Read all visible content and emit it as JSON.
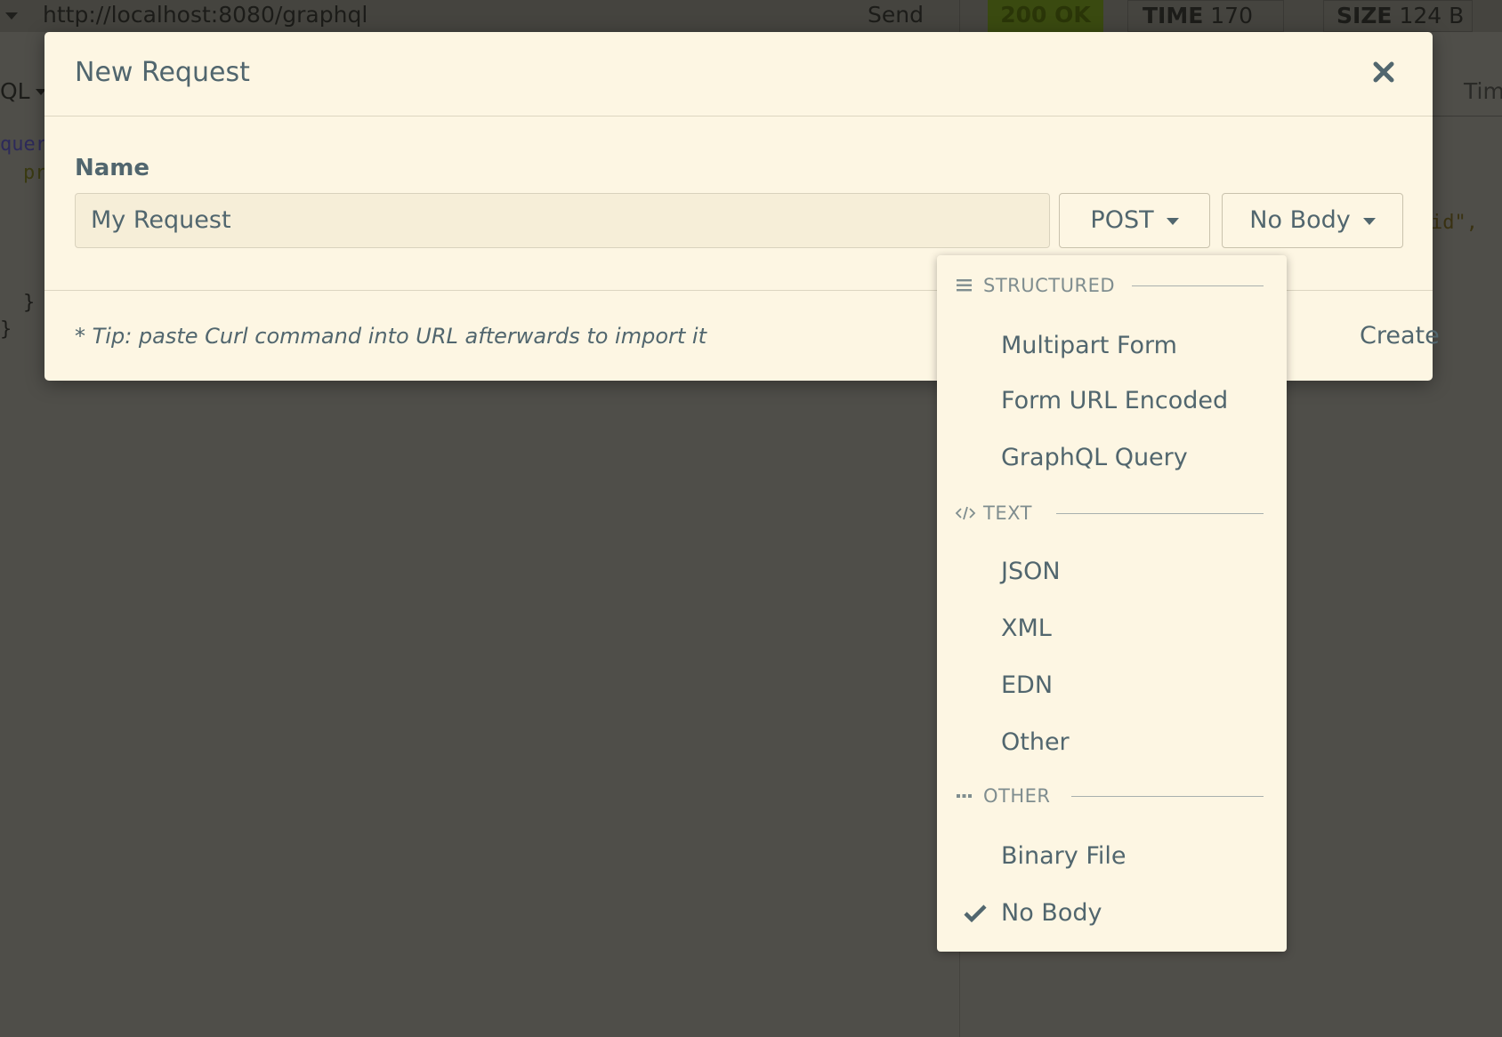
{
  "background": {
    "url": "http://localhost:8080/graphql",
    "send_label": "Send",
    "status": "200 OK",
    "time_label": "TIME",
    "time_value": "170 ms",
    "size_label": "SIZE",
    "size_value": "124 B",
    "left_pane_label": "QL",
    "code_keyword": "quer",
    "code_prop": "pr",
    "code_brace1": "}",
    "code_brace2": "}",
    "code_right": "id\",",
    "right_pane_tab": "Tim"
  },
  "modal": {
    "title": "New Request",
    "name_label": "Name",
    "name_value": "My Request",
    "method": "POST",
    "body_type": "No Body",
    "tip": "* Tip: paste Curl command into URL afterwards to import it",
    "create_label": "Create"
  },
  "dropdown": {
    "sections": [
      {
        "label": "STRUCTURED",
        "icon": "bars-icon"
      },
      {
        "label": "TEXT",
        "icon": "code-icon"
      },
      {
        "label": "OTHER",
        "icon": "ellipsis-icon"
      }
    ],
    "items": [
      {
        "label": "Multipart Form",
        "selected": false
      },
      {
        "label": "Form URL Encoded",
        "selected": false
      },
      {
        "label": "GraphQL Query",
        "selected": false
      },
      {
        "label": "JSON",
        "selected": false
      },
      {
        "label": "XML",
        "selected": false
      },
      {
        "label": "EDN",
        "selected": false
      },
      {
        "label": "Other",
        "selected": false
      },
      {
        "label": "Binary File",
        "selected": false
      },
      {
        "label": "No Body",
        "selected": true
      }
    ]
  },
  "colors": {
    "modal_bg": "#fdf6e3",
    "text": "#51666e",
    "backdrop": "#4f4e49",
    "status_ok_bg": "#3a4a10"
  }
}
